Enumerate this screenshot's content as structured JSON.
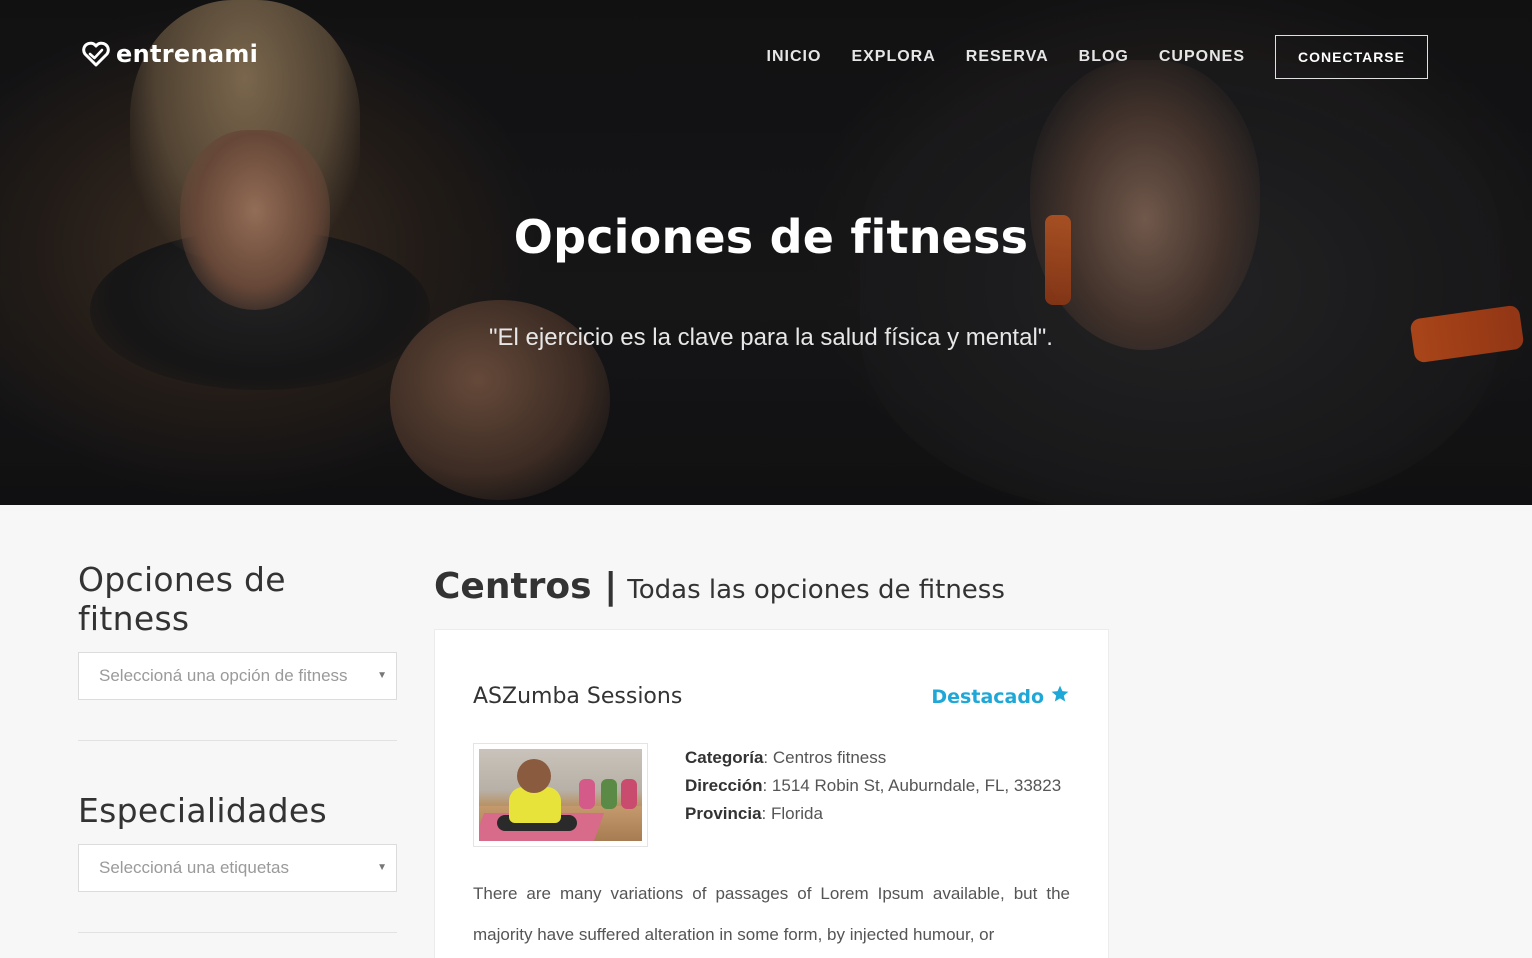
{
  "header": {
    "brand": "entrenami",
    "nav": [
      {
        "label": "INICIO"
      },
      {
        "label": "EXPLORA"
      },
      {
        "label": "RESERVA"
      },
      {
        "label": "BLOG"
      },
      {
        "label": "CUPONES"
      }
    ],
    "login_label": "CONECTARSE"
  },
  "hero": {
    "title": "Opciones de fitness",
    "quote": "\"El ejercicio es la clave para la salud física y mental\"."
  },
  "sidebar": {
    "fitness_heading": "Opciones de fitness",
    "fitness_placeholder": "Seleccioná una opción de fitness",
    "specialties_heading": "Especialidades",
    "specialties_placeholder": "Seleccioná una etiquetas"
  },
  "main": {
    "heading": "Centros |",
    "subheading": "Todas las opciones de fitness",
    "listing": {
      "title": "ASZumba Sessions",
      "badge": "Destacado",
      "category_label": "Categoría",
      "category_value": ": Centros fitness",
      "address_label": "Dirección",
      "address_value": ": 1514 Robin St, Auburndale, FL, 33823",
      "province_label": "Provincia",
      "province_value": ": Florida",
      "description": "There are many variations of passages of Lorem Ipsum available, but the majority have suffered alteration in some form, by injected humour, or"
    }
  },
  "colors": {
    "accent": "#1fa7d8",
    "page_bg": "#f7f7f7"
  },
  "icons": {
    "logo": "heart-logo-icon",
    "featured": "star-icon",
    "select_caret": "caret-down-icon"
  }
}
